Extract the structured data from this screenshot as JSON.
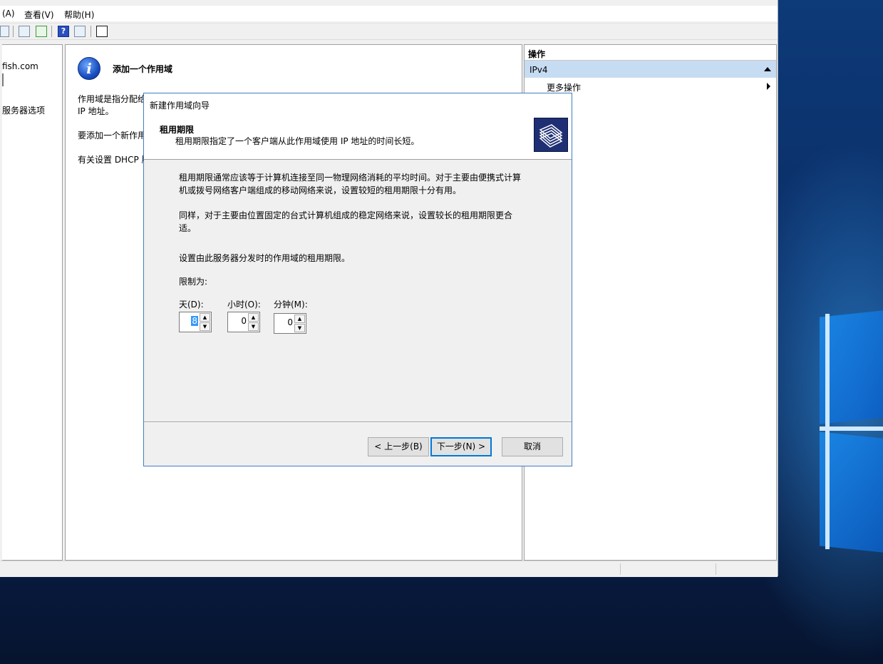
{
  "menubar": {
    "items": [
      "(A)",
      "查看(V)",
      "帮助(H)"
    ]
  },
  "tree": {
    "items": [
      "fish.com",
      "服务器选项"
    ]
  },
  "center": {
    "heading": "添加一个作用域",
    "para1_line1": "作用域是指分配给",
    "para1_line2": "IP 地址。",
    "para2": "要添加一个新作用",
    "para3": "有关设置 DHCP 肌"
  },
  "actions": {
    "header": "操作",
    "section": "IPv4",
    "more": "更多操作"
  },
  "dialog": {
    "title": "新建作用域向导",
    "page_title": "租用期限",
    "page_subtitle": "租用期限指定了一个客户端从此作用域使用 IP 地址的时间长短。",
    "desc1_line1": "租用期限通常应该等于计算机连接至同一物理网络消耗的平均时间。对于主要由便携式计算",
    "desc1_line2": "机或拨号网络客户端组成的移动网络来说，设置较短的租用期限十分有用。",
    "desc2_line1": "同样，对于主要由位置固定的台式计算机组成的稳定网络来说，设置较长的租用期限更合",
    "desc2_line2": "适。",
    "desc3": "设置由此服务器分发时的作用域的租用期限。",
    "limit_label": "限制为:",
    "days_label": "天(D):",
    "hours_label": "小时(O):",
    "minutes_label": "分钟(M):",
    "days_value": "8",
    "hours_value": "0",
    "minutes_value": "0",
    "back_button": "< 上一步(B)",
    "next_button": "下一步(N) >",
    "cancel_button": "取消"
  }
}
